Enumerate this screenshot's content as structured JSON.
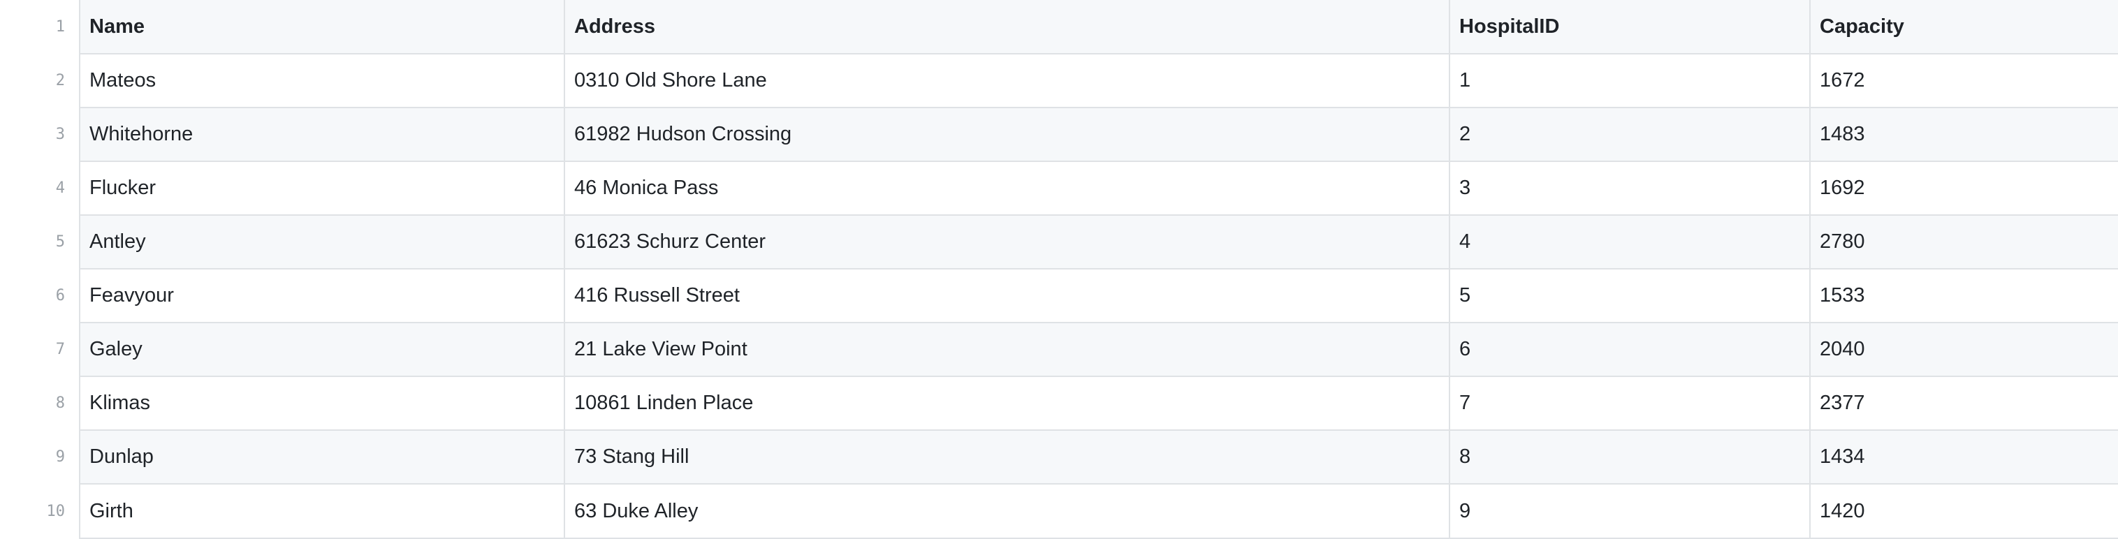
{
  "table": {
    "line_numbers": [
      "1",
      "2",
      "3",
      "4",
      "5",
      "6",
      "7",
      "8",
      "9",
      "10"
    ],
    "columns": [
      "Name",
      "Address",
      "HospitalID",
      "Capacity"
    ],
    "rows": [
      [
        "Mateos",
        "0310 Old Shore Lane",
        "1",
        "1672"
      ],
      [
        "Whitehorne",
        "61982 Hudson Crossing",
        "2",
        "1483"
      ],
      [
        "Flucker",
        "46 Monica Pass",
        "3",
        "1692"
      ],
      [
        "Antley",
        "61623 Schurz Center",
        "4",
        "2780"
      ],
      [
        "Feavyour",
        "416 Russell Street",
        "5",
        "1533"
      ],
      [
        "Galey",
        "21 Lake View Point",
        "6",
        "2040"
      ],
      [
        "Klimas",
        "10861 Linden Place",
        "7",
        "2377"
      ],
      [
        "Dunlap",
        "73 Stang Hill",
        "8",
        "1434"
      ],
      [
        "Girth",
        "63 Duke Alley",
        "9",
        "1420"
      ]
    ]
  },
  "colors": {
    "header_background": "#f6f8fa",
    "stripe_background": "#f6f8fa",
    "row_background": "#ffffff",
    "border": "#dfe2e5",
    "line_number_text": "#9aa0a6",
    "text": "#1f2328"
  }
}
